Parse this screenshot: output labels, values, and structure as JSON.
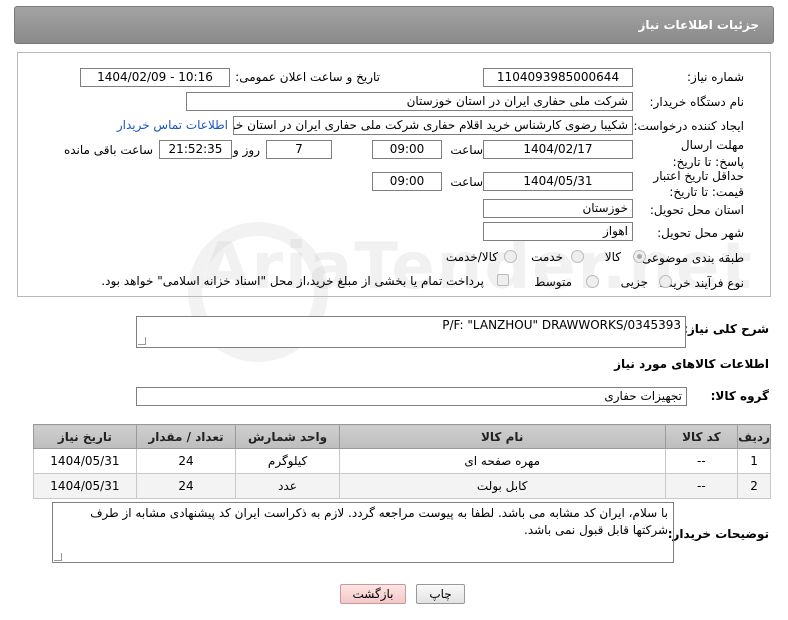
{
  "header": {
    "title": "جزئیات اطلاعات نیاز"
  },
  "form": {
    "need_number": {
      "label": "شماره نیاز:",
      "value": "1104093985000644"
    },
    "announce": {
      "label": "تاریخ و ساعت اعلان عمومی:",
      "value": "1404/02/09 - 10:16"
    },
    "buyer": {
      "label": "نام دستگاه خریدار:",
      "value": "شرکت ملی حفاری ایران در استان خوزستان"
    },
    "creator": {
      "label": "ایجاد کننده درخواست:",
      "value": "شکیبا رضوی کارشناس خرید اقلام حفاری شرکت ملی حفاری ایران در استان خو",
      "contact_link": "اطلاعات تماس خریدار"
    },
    "reply_deadline": {
      "label": "مهلت ارسال پاسخ: تا تاریخ:",
      "date": "1404/02/17",
      "time_label": "ساعت",
      "time": "09:00",
      "days": "7",
      "days_label": "روز و",
      "remaining": "21:52:35",
      "remaining_label": "ساعت باقی مانده"
    },
    "price_deadline": {
      "label": "حداقل تاریخ اعتبار قیمت: تا تاریخ:",
      "date": "1404/05/31",
      "time_label": "ساعت",
      "time": "09:00"
    },
    "province": {
      "label": "استان محل تحویل:",
      "value": "خوزستان"
    },
    "city": {
      "label": "شهر محل تحویل:",
      "value": "اهواز"
    },
    "category": {
      "label": "طبقه بندی موضوعی:",
      "options": [
        "کالا",
        "خدمت",
        "کالا/خدمت"
      ],
      "selected": "کالا"
    },
    "process": {
      "label": "نوع فرآیند خرید :",
      "options": [
        "جزیی",
        "متوسط"
      ],
      "selected": "",
      "payment_note": "پرداخت تمام یا بخشی از مبلغ خرید،از محل \"اسناد خزانه اسلامی\" خواهد بود."
    }
  },
  "description": {
    "label": "شرح کلی نیاز:",
    "value": "P/F: \"LANZHOU\" DRAWWORKS/0345393"
  },
  "goods_section": {
    "title": "اطلاعات کالاهای مورد نیاز",
    "group_label": "گروه کالا:",
    "group_value": "تجهیزات حفاری"
  },
  "table": {
    "headers": [
      "ردیف",
      "کد کالا",
      "نام کالا",
      "واحد شمارش",
      "تعداد / مقدار",
      "تاریخ نیاز"
    ],
    "rows": [
      [
        "1",
        "--",
        "مهره صفحه ای",
        "کیلوگرم",
        "24",
        "1404/05/31"
      ],
      [
        "2",
        "--",
        "کابل بولت",
        "عدد",
        "24",
        "1404/05/31"
      ]
    ]
  },
  "buyer_notes": {
    "label": "توضیحات خریدار:",
    "value": "با سلام، ایران کد مشابه می باشد. لطفا به پیوست مراجعه گردد. لازم به ذکراست ایران کد پیشنهادی مشابه از طرف شرکتها قابل قبول نمی باشد."
  },
  "buttons": {
    "print": "چاپ",
    "back": "بازگشت"
  },
  "watermark": "AriaTender.net"
}
